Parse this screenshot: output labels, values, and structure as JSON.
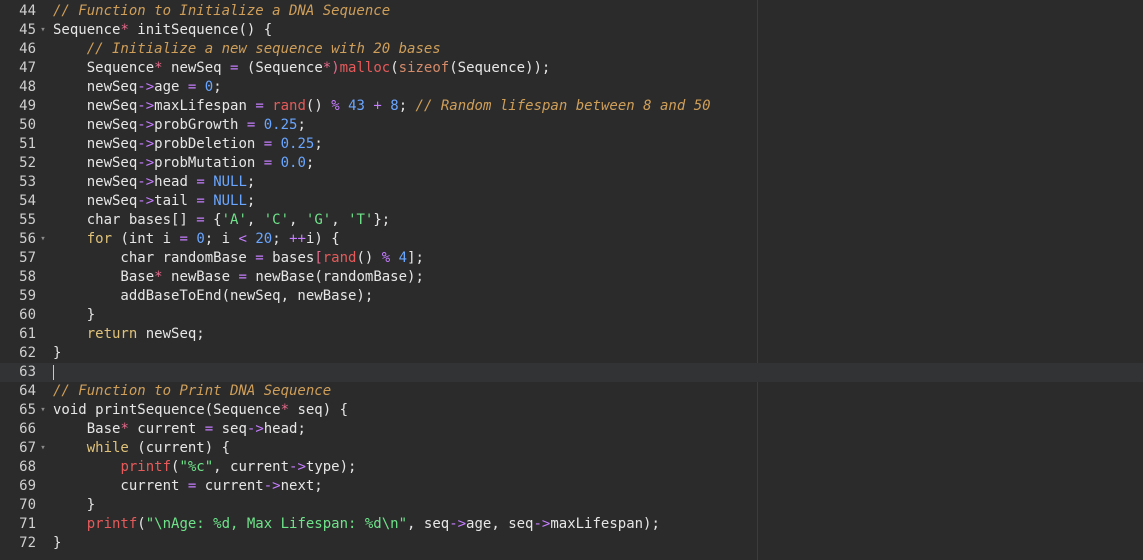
{
  "editor": {
    "lines": [
      {
        "n": "44",
        "fold": "",
        "segs": [
          {
            "t": "// Function to Initialize a DNA Sequence",
            "c": "comment"
          }
        ]
      },
      {
        "n": "45",
        "fold": "▾",
        "segs": [
          {
            "t": "Sequence",
            "c": "txt"
          },
          {
            "t": "*",
            "c": "sym"
          },
          {
            "t": " initSequence() {",
            "c": "txt"
          }
        ]
      },
      {
        "n": "46",
        "fold": "",
        "segs": [
          {
            "t": "    ",
            "c": "txt"
          },
          {
            "t": "// Initialize a new sequence with 20 bases",
            "c": "comment"
          }
        ]
      },
      {
        "n": "47",
        "fold": "",
        "segs": [
          {
            "t": "    Sequence",
            "c": "txt"
          },
          {
            "t": "*",
            "c": "sym"
          },
          {
            "t": " newSeq ",
            "c": "txt"
          },
          {
            "t": "=",
            "c": "op"
          },
          {
            "t": " (Sequence",
            "c": "txt"
          },
          {
            "t": "*)",
            "c": "sym"
          },
          {
            "t": "malloc",
            "c": "fn"
          },
          {
            "t": "(",
            "c": "txt"
          },
          {
            "t": "sizeof",
            "c": "kw"
          },
          {
            "t": "(Sequence));",
            "c": "txt"
          }
        ]
      },
      {
        "n": "48",
        "fold": "",
        "segs": [
          {
            "t": "    newSeq",
            "c": "txt"
          },
          {
            "t": "->",
            "c": "op"
          },
          {
            "t": "age ",
            "c": "txt"
          },
          {
            "t": "=",
            "c": "op"
          },
          {
            "t": " ",
            "c": "txt"
          },
          {
            "t": "0",
            "c": "num"
          },
          {
            "t": ";",
            "c": "txt"
          }
        ]
      },
      {
        "n": "49",
        "fold": "",
        "segs": [
          {
            "t": "    newSeq",
            "c": "txt"
          },
          {
            "t": "->",
            "c": "op"
          },
          {
            "t": "maxLifespan ",
            "c": "txt"
          },
          {
            "t": "=",
            "c": "op"
          },
          {
            "t": " ",
            "c": "txt"
          },
          {
            "t": "rand",
            "c": "fn"
          },
          {
            "t": "() ",
            "c": "txt"
          },
          {
            "t": "%",
            "c": "op"
          },
          {
            "t": " ",
            "c": "txt"
          },
          {
            "t": "43",
            "c": "num"
          },
          {
            "t": " ",
            "c": "txt"
          },
          {
            "t": "+",
            "c": "op"
          },
          {
            "t": " ",
            "c": "txt"
          },
          {
            "t": "8",
            "c": "num"
          },
          {
            "t": "; ",
            "c": "txt"
          },
          {
            "t": "// Random lifespan between 8 and 50",
            "c": "comment"
          }
        ]
      },
      {
        "n": "50",
        "fold": "",
        "segs": [
          {
            "t": "    newSeq",
            "c": "txt"
          },
          {
            "t": "->",
            "c": "op"
          },
          {
            "t": "probGrowth ",
            "c": "txt"
          },
          {
            "t": "=",
            "c": "op"
          },
          {
            "t": " ",
            "c": "txt"
          },
          {
            "t": "0.25",
            "c": "num"
          },
          {
            "t": ";",
            "c": "txt"
          }
        ]
      },
      {
        "n": "51",
        "fold": "",
        "segs": [
          {
            "t": "    newSeq",
            "c": "txt"
          },
          {
            "t": "->",
            "c": "op"
          },
          {
            "t": "probDeletion ",
            "c": "txt"
          },
          {
            "t": "=",
            "c": "op"
          },
          {
            "t": " ",
            "c": "txt"
          },
          {
            "t": "0.25",
            "c": "num"
          },
          {
            "t": ";",
            "c": "txt"
          }
        ]
      },
      {
        "n": "52",
        "fold": "",
        "segs": [
          {
            "t": "    newSeq",
            "c": "txt"
          },
          {
            "t": "->",
            "c": "op"
          },
          {
            "t": "probMutation ",
            "c": "txt"
          },
          {
            "t": "=",
            "c": "op"
          },
          {
            "t": " ",
            "c": "txt"
          },
          {
            "t": "0.0",
            "c": "num"
          },
          {
            "t": ";",
            "c": "txt"
          }
        ]
      },
      {
        "n": "53",
        "fold": "",
        "segs": [
          {
            "t": "    newSeq",
            "c": "txt"
          },
          {
            "t": "->",
            "c": "op"
          },
          {
            "t": "head ",
            "c": "txt"
          },
          {
            "t": "=",
            "c": "op"
          },
          {
            "t": " ",
            "c": "txt"
          },
          {
            "t": "NULL",
            "c": "null"
          },
          {
            "t": ";",
            "c": "txt"
          }
        ]
      },
      {
        "n": "54",
        "fold": "",
        "segs": [
          {
            "t": "    newSeq",
            "c": "txt"
          },
          {
            "t": "->",
            "c": "op"
          },
          {
            "t": "tail ",
            "c": "txt"
          },
          {
            "t": "=",
            "c": "op"
          },
          {
            "t": " ",
            "c": "txt"
          },
          {
            "t": "NULL",
            "c": "null"
          },
          {
            "t": ";",
            "c": "txt"
          }
        ]
      },
      {
        "n": "55",
        "fold": "",
        "segs": [
          {
            "t": "    char bases[] ",
            "c": "txt"
          },
          {
            "t": "=",
            "c": "op"
          },
          {
            "t": " {",
            "c": "txt"
          },
          {
            "t": "'A'",
            "c": "str"
          },
          {
            "t": ", ",
            "c": "txt"
          },
          {
            "t": "'C'",
            "c": "str"
          },
          {
            "t": ", ",
            "c": "txt"
          },
          {
            "t": "'G'",
            "c": "str"
          },
          {
            "t": ", ",
            "c": "txt"
          },
          {
            "t": "'T'",
            "c": "str"
          },
          {
            "t": "};",
            "c": "txt"
          }
        ]
      },
      {
        "n": "56",
        "fold": "▾",
        "segs": [
          {
            "t": "    ",
            "c": "txt"
          },
          {
            "t": "for",
            "c": "keyword"
          },
          {
            "t": " (int i ",
            "c": "txt"
          },
          {
            "t": "=",
            "c": "op"
          },
          {
            "t": " ",
            "c": "txt"
          },
          {
            "t": "0",
            "c": "num"
          },
          {
            "t": "; i ",
            "c": "txt"
          },
          {
            "t": "<",
            "c": "op"
          },
          {
            "t": " ",
            "c": "txt"
          },
          {
            "t": "20",
            "c": "num"
          },
          {
            "t": "; ",
            "c": "txt"
          },
          {
            "t": "++",
            "c": "op"
          },
          {
            "t": "i) {",
            "c": "txt"
          }
        ]
      },
      {
        "n": "57",
        "fold": "",
        "segs": [
          {
            "t": "        char randomBase ",
            "c": "txt"
          },
          {
            "t": "=",
            "c": "op"
          },
          {
            "t": " bases",
            "c": "txt"
          },
          {
            "t": "[",
            "c": "sym"
          },
          {
            "t": "rand",
            "c": "fn"
          },
          {
            "t": "() ",
            "c": "txt"
          },
          {
            "t": "%",
            "c": "op"
          },
          {
            "t": " ",
            "c": "txt"
          },
          {
            "t": "4",
            "c": "num"
          },
          {
            "t": "];",
            "c": "txt"
          }
        ]
      },
      {
        "n": "58",
        "fold": "",
        "segs": [
          {
            "t": "        Base",
            "c": "txt"
          },
          {
            "t": "*",
            "c": "sym"
          },
          {
            "t": " newBase ",
            "c": "txt"
          },
          {
            "t": "=",
            "c": "op"
          },
          {
            "t": " newBase(randomBase);",
            "c": "txt"
          }
        ]
      },
      {
        "n": "59",
        "fold": "",
        "segs": [
          {
            "t": "        addBaseToEnd(newSeq, newBase);",
            "c": "txt"
          }
        ]
      },
      {
        "n": "60",
        "fold": "",
        "segs": [
          {
            "t": "    }",
            "c": "txt"
          }
        ]
      },
      {
        "n": "61",
        "fold": "",
        "segs": [
          {
            "t": "    ",
            "c": "txt"
          },
          {
            "t": "return",
            "c": "keyword"
          },
          {
            "t": " newSeq;",
            "c": "txt"
          }
        ]
      },
      {
        "n": "62",
        "fold": "",
        "segs": [
          {
            "t": "}",
            "c": "txt"
          }
        ]
      },
      {
        "n": "63",
        "fold": "",
        "segs": [],
        "active": true
      },
      {
        "n": "64",
        "fold": "",
        "segs": [
          {
            "t": "// Function to Print DNA Sequence",
            "c": "comment"
          }
        ]
      },
      {
        "n": "65",
        "fold": "▾",
        "segs": [
          {
            "t": "void printSequence(Sequence",
            "c": "txt"
          },
          {
            "t": "*",
            "c": "sym"
          },
          {
            "t": " seq) {",
            "c": "txt"
          }
        ]
      },
      {
        "n": "66",
        "fold": "",
        "segs": [
          {
            "t": "    Base",
            "c": "txt"
          },
          {
            "t": "*",
            "c": "sym"
          },
          {
            "t": " current ",
            "c": "txt"
          },
          {
            "t": "=",
            "c": "op"
          },
          {
            "t": " seq",
            "c": "txt"
          },
          {
            "t": "->",
            "c": "op"
          },
          {
            "t": "head;",
            "c": "txt"
          }
        ]
      },
      {
        "n": "67",
        "fold": "▾",
        "segs": [
          {
            "t": "    ",
            "c": "txt"
          },
          {
            "t": "while",
            "c": "keyword"
          },
          {
            "t": " (current) {",
            "c": "txt"
          }
        ]
      },
      {
        "n": "68",
        "fold": "",
        "segs": [
          {
            "t": "        ",
            "c": "txt"
          },
          {
            "t": "printf",
            "c": "fn"
          },
          {
            "t": "(",
            "c": "txt"
          },
          {
            "t": "\"%c\"",
            "c": "str"
          },
          {
            "t": ", current",
            "c": "txt"
          },
          {
            "t": "->",
            "c": "op"
          },
          {
            "t": "type);",
            "c": "txt"
          }
        ]
      },
      {
        "n": "69",
        "fold": "",
        "segs": [
          {
            "t": "        current ",
            "c": "txt"
          },
          {
            "t": "=",
            "c": "op"
          },
          {
            "t": " current",
            "c": "txt"
          },
          {
            "t": "->",
            "c": "op"
          },
          {
            "t": "next;",
            "c": "txt"
          }
        ]
      },
      {
        "n": "70",
        "fold": "",
        "segs": [
          {
            "t": "    }",
            "c": "txt"
          }
        ]
      },
      {
        "n": "71",
        "fold": "",
        "segs": [
          {
            "t": "    ",
            "c": "txt"
          },
          {
            "t": "printf",
            "c": "fn"
          },
          {
            "t": "(",
            "c": "txt"
          },
          {
            "t": "\"\\nAge: %d, Max Lifespan: %d\\n\"",
            "c": "str"
          },
          {
            "t": ", seq",
            "c": "txt"
          },
          {
            "t": "->",
            "c": "op"
          },
          {
            "t": "age, seq",
            "c": "txt"
          },
          {
            "t": "->",
            "c": "op"
          },
          {
            "t": "maxLifespan);",
            "c": "txt"
          }
        ]
      },
      {
        "n": "72",
        "fold": "",
        "segs": [
          {
            "t": "}",
            "c": "txt"
          }
        ]
      }
    ]
  }
}
